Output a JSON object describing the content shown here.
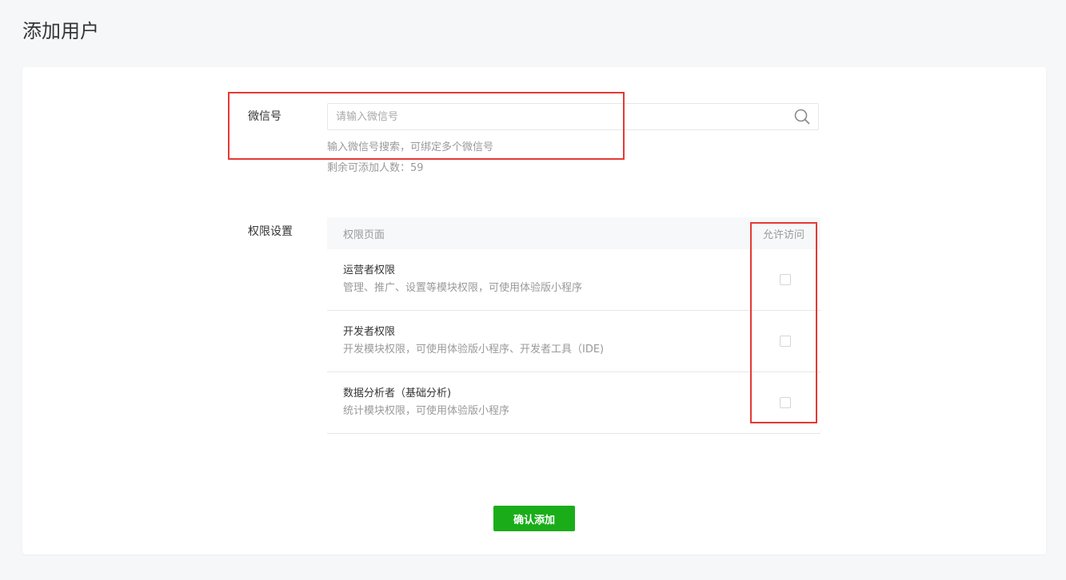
{
  "page": {
    "title": "添加用户"
  },
  "wechat": {
    "label": "微信号",
    "placeholder": "请输入微信号",
    "value": "",
    "hint": "输入微信号搜索，可绑定多个微信号",
    "remaining": "剩余可添加人数：59",
    "icon": "search-icon"
  },
  "permissions": {
    "label": "权限设置",
    "header": {
      "page": "权限页面",
      "allow": "允许访问"
    },
    "rows": [
      {
        "title": "运营者权限",
        "desc": "管理、推广、设置等模块权限，可使用体验版小程序",
        "checked": false
      },
      {
        "title": "开发者权限",
        "desc": "开发模块权限，可使用体验版小程序、开发者工具（IDE)",
        "checked": false
      },
      {
        "title": "数据分析者（基础分析)",
        "desc": "统计模块权限，可使用体验版小程序",
        "checked": false
      }
    ]
  },
  "actions": {
    "confirm_label": "确认添加"
  },
  "colors": {
    "primary": "#1aad19",
    "highlight": "#e53935",
    "background": "#f6f7f9"
  }
}
